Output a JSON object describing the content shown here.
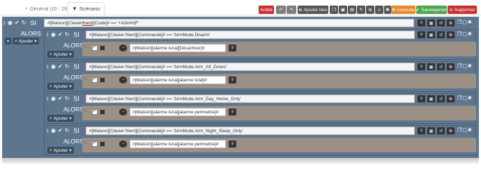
{
  "tabs": [
    {
      "label": "Général (ID : 29)",
      "icon": "tachometer-icon"
    },
    {
      "label": "Scénario",
      "icon": "filter-icon"
    }
  ],
  "toolbar": {
    "stopped_label": "Arrêté",
    "add_block_label": "Ajouter bloc",
    "execute_label": "Exécuter",
    "save_label": "Sauvegarder",
    "delete_label": "Supprimer"
  },
  "colors": {
    "scenario_bg": "#5d768e",
    "action_band": "#9b8f86",
    "stopped": "#c8302c",
    "execute": "#e5892a",
    "save": "#4ca54c",
    "delete": "#c9302c"
  },
  "main": {
    "si_label": "SI",
    "alors_label": "ALORS",
    "ajouter_label": "Ajouter",
    "outer_condition": "#[Maison][Clavier frient][Code]# == '+A3###|F'",
    "outer_condition_prefix": "#[Maison][Clavier ",
    "outer_condition_underlined": "frient",
    "outer_condition_suffix": "][Code]# == '+A3###|F'",
    "blocks": [
      {
        "condition": "#[Maison][Clavier frient][Commande]# == 'ArmMode.Disarm'",
        "action": "#[Maison][alarme luna][Désactiver]#"
      },
      {
        "condition": "#[Maison][Clavier frient][Commande]# == 'ArmMode.Arm_All_Zones'",
        "action": "#[Maison][alarme luna][alarme total]#"
      },
      {
        "condition": "#[Maison][Clavier frient][Commande]# == 'ArmMode.Arm_Day_Home_Only'",
        "action": "#[Maison][alarme luna][alarme perimetrie]#"
      },
      {
        "condition": "#[Maison][Clavier frient][Commande]# == 'ArmMode.Arm_Night_Sleep_Only'",
        "action": "#[Maison][alarme luna][alarme perimetrie]#"
      }
    ]
  }
}
